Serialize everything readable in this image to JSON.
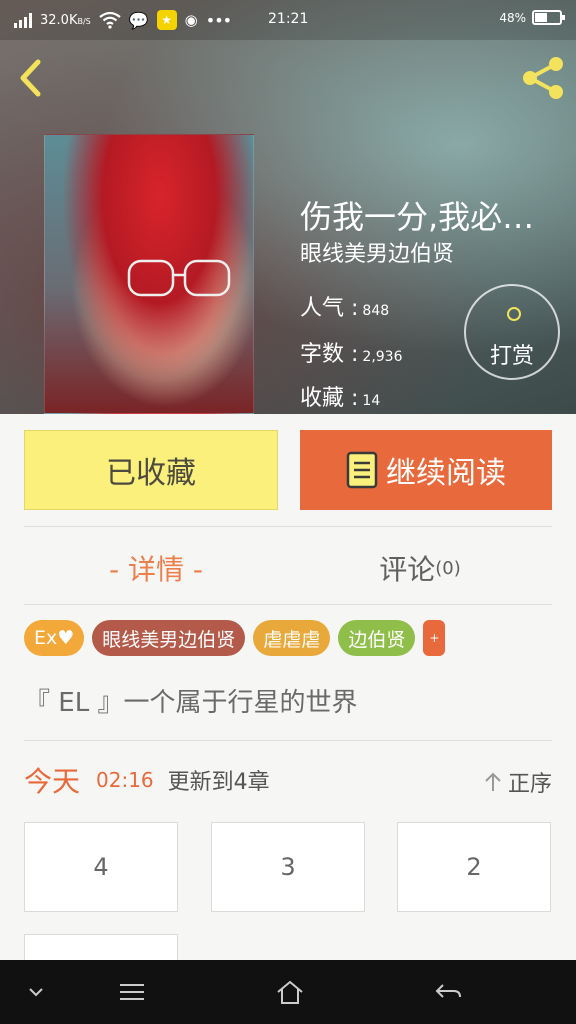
{
  "status_bar": {
    "speed": "32.0K",
    "speed_unit": "B/S",
    "time": "21:21",
    "battery": "48%"
  },
  "book": {
    "title": "伤我一分,我必…",
    "author": "眼线美男边伯贤",
    "stats": [
      {
        "label": "人气 :",
        "value": "848"
      },
      {
        "label": "字数 :",
        "value": "2,936"
      },
      {
        "label": "收藏 :",
        "value": "14"
      }
    ],
    "reward_label": "打赏"
  },
  "actions": {
    "favorited_label": "已收藏",
    "continue_label": "继续阅读"
  },
  "tabs": {
    "detail_label": "-  详情  -",
    "comment_label": "评论",
    "comment_count": "(0)"
  },
  "tags": [
    {
      "label": "Ex♥",
      "color": "#f3a83a"
    },
    {
      "label": "眼线美男边伯贤",
      "color": "#b45a4a"
    },
    {
      "label": "虐虐虐",
      "color": "#e8a93a"
    },
    {
      "label": "边伯贤",
      "color": "#8fbf4a"
    },
    {
      "label": "+",
      "color": "#e8693b"
    }
  ],
  "description": "『 EL 』一个属于行星的世界",
  "update": {
    "day": "今天",
    "time": "02:16",
    "text": "更新到4章",
    "order_label": "正序"
  },
  "chapters": [
    "4",
    "3",
    "2",
    ""
  ],
  "colors": {
    "accent_orange": "#e8693b",
    "favorite_yellow": "#fbf07c"
  }
}
